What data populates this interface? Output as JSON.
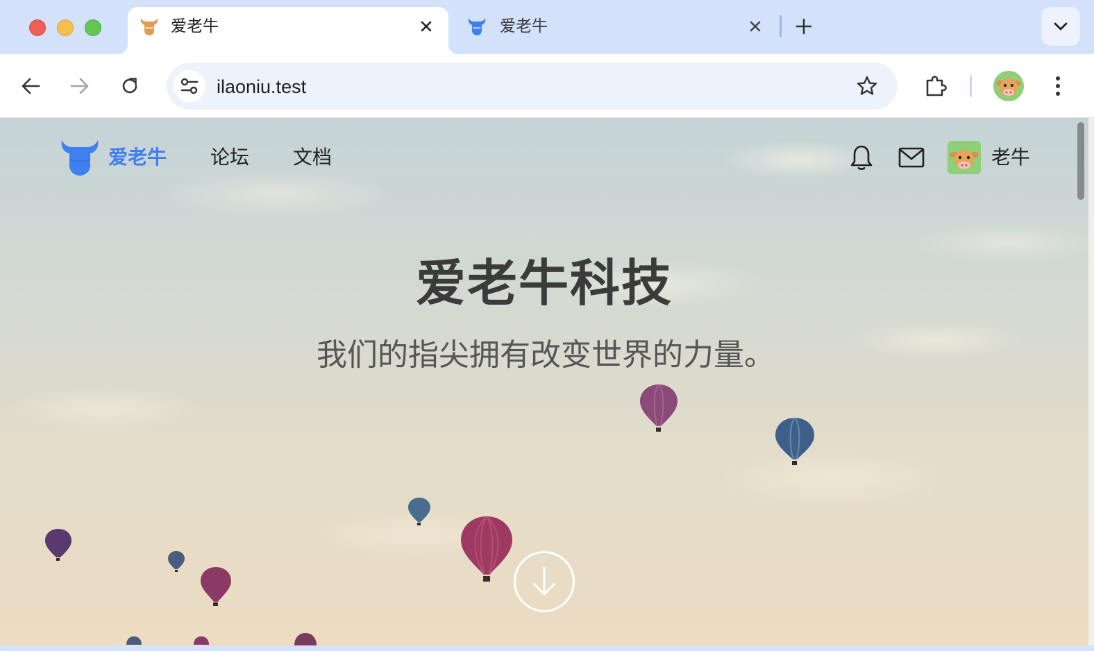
{
  "browser": {
    "tabs": [
      {
        "title": "爱老牛",
        "active": true,
        "favicon": "orange-bull-icon"
      },
      {
        "title": "爱老牛",
        "active": false,
        "favicon": "blue-bull-icon"
      }
    ],
    "address": "ilaoniu.test"
  },
  "site": {
    "brand": "爱老牛",
    "nav": {
      "forum": "论坛",
      "docs": "文档"
    },
    "user": {
      "name": "老牛"
    }
  },
  "hero": {
    "title": "爱老牛科技",
    "subtitle": "我们的指尖拥有改变世界的力量。"
  },
  "colors": {
    "brand_blue": "#3f7ff0",
    "tab_orange": "#e49a4e",
    "tabstrip_bg": "#d3e1fb"
  }
}
